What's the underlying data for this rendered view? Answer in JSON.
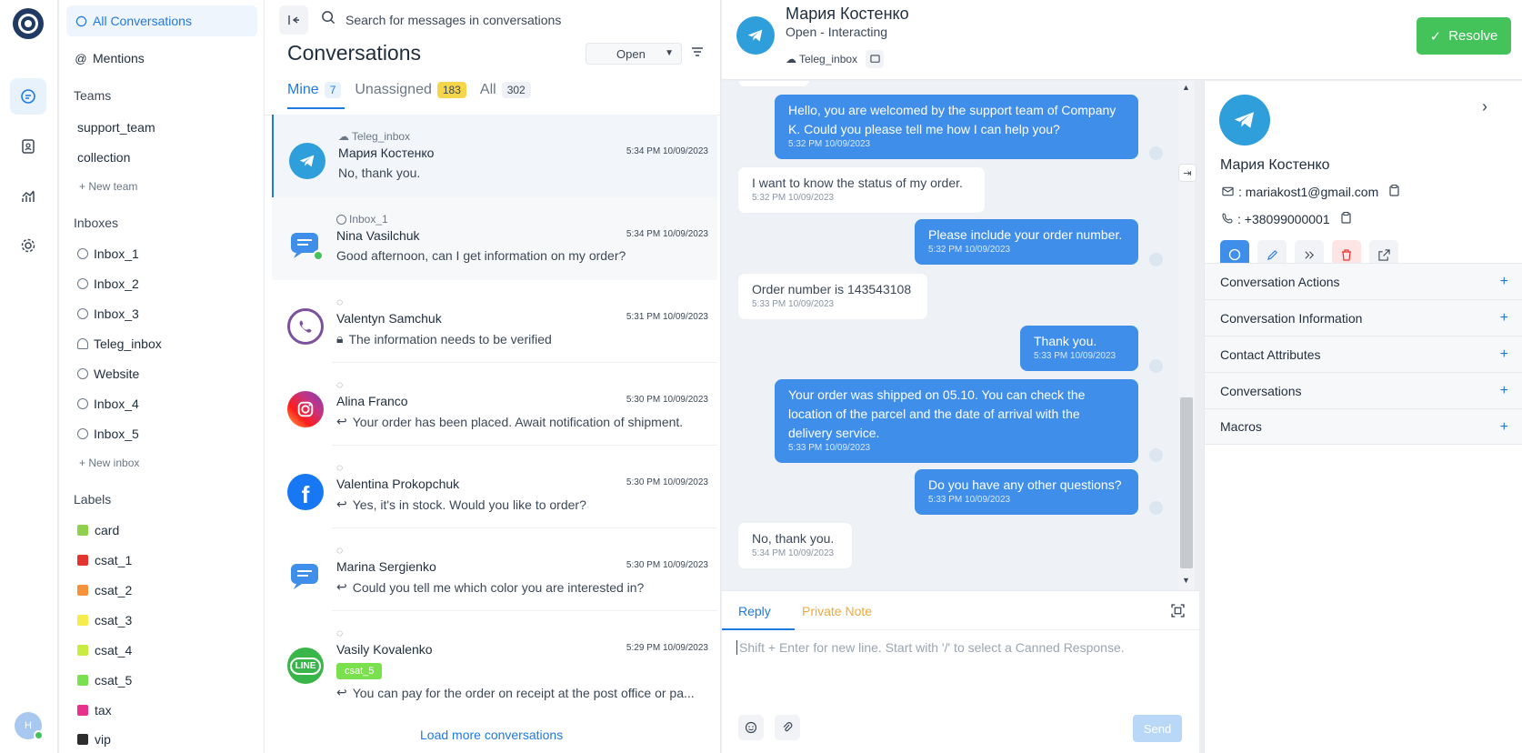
{
  "rail": {
    "avatar_initial": "H",
    "items": [
      {
        "name": "conversations-icon",
        "active": true
      },
      {
        "name": "contacts-icon",
        "active": false
      },
      {
        "name": "reports-icon",
        "active": false
      },
      {
        "name": "settings-icon",
        "active": false
      }
    ]
  },
  "sidebar": {
    "all_conversations": "All Conversations",
    "mentions": "Mentions",
    "teams_heading": "Teams",
    "teams": [
      "support_team",
      "collection"
    ],
    "new_team": "New team",
    "inboxes_heading": "Inboxes",
    "inboxes": [
      "Inbox_1",
      "Inbox_2",
      "Inbox_3",
      "Teleg_inbox",
      "Website",
      "Inbox_4",
      "Inbox_5"
    ],
    "new_inbox": "New inbox",
    "labels_heading": "Labels",
    "labels": [
      {
        "name": "card",
        "color": "#8fd14f"
      },
      {
        "name": "csat_1",
        "color": "#e3342f"
      },
      {
        "name": "csat_2",
        "color": "#f6923a"
      },
      {
        "name": "csat_3",
        "color": "#f7ec4e"
      },
      {
        "name": "csat_4",
        "color": "#c8ec3f"
      },
      {
        "name": "csat_5",
        "color": "#7ae04d"
      },
      {
        "name": "tax",
        "color": "#e8318c"
      },
      {
        "name": "vip",
        "color": "#2d2d2d"
      }
    ]
  },
  "list": {
    "search_placeholder": "Search for messages in conversations",
    "title": "Conversations",
    "status": "Open",
    "tabs": [
      {
        "label": "Mine",
        "count": "7"
      },
      {
        "label": "Unassigned",
        "count": "183"
      },
      {
        "label": "All",
        "count": "302"
      }
    ],
    "conversations": [
      {
        "inbox": "Teleg_inbox",
        "name": "Мария Костенко",
        "time": "5:34 PM 10/09/2023",
        "message": "No, thank you.",
        "channel": "telegram",
        "reply": false,
        "lock": false
      },
      {
        "inbox": "Inbox_1",
        "name": "Nina Vasilchuk",
        "time": "5:34 PM 10/09/2023",
        "message": "Good afternoon, can I get information on my order?",
        "channel": "web",
        "reply": false,
        "lock": false
      },
      {
        "inbox": "",
        "name": "Valentyn Samchuk",
        "time": "5:31 PM 10/09/2023",
        "message": "The information needs to be verified",
        "channel": "viber",
        "reply": false,
        "lock": true
      },
      {
        "inbox": "",
        "name": "Alina Franco",
        "time": "5:30 PM 10/09/2023",
        "message": "Your order has been placed. Await notification of shipment.",
        "channel": "instagram",
        "reply": true,
        "lock": false
      },
      {
        "inbox": "",
        "name": "Valentina Prokopchuk",
        "time": "5:30 PM 10/09/2023",
        "message": "Yes, it's in stock. Would you like to order?",
        "channel": "facebook",
        "reply": true,
        "lock": false
      },
      {
        "inbox": "",
        "name": "Marina Sergienko",
        "time": "5:30 PM 10/09/2023",
        "message": "Could you tell me which color you are interested in?",
        "channel": "web",
        "reply": true,
        "lock": false
      },
      {
        "inbox": "",
        "name": "Vasily Kovalenko",
        "time": "5:29 PM 10/09/2023",
        "message": "You can pay for the order on receipt at the post office or pa...",
        "channel": "line",
        "reply": true,
        "lock": false,
        "label": "csat_5"
      }
    ],
    "load_more": "Load more conversations"
  },
  "chat": {
    "name": "Мария Костенко",
    "status": "Open - Interacting",
    "inbox": "Teleg_inbox",
    "resolve_label": "Resolve",
    "messages": [
      {
        "dir": "out",
        "text": "Hello, you are welcomed by the support team of Company K. Could you please tell me how I can help you?",
        "time": "5:32 PM 10/09/2023"
      },
      {
        "dir": "in",
        "text": "I want to know the status of my order.",
        "time": "5:32 PM 10/09/2023"
      },
      {
        "dir": "out",
        "text": "Please include your order number.",
        "time": "5:32 PM 10/09/2023"
      },
      {
        "dir": "in",
        "text": "Order number is 143543108",
        "time": "5:33 PM 10/09/2023"
      },
      {
        "dir": "out",
        "text": "Thank you.",
        "time": "5:33 PM 10/09/2023"
      },
      {
        "dir": "out",
        "text": "Your order was shipped on 05.10. You can check the location of the parcel and the date of arrival with the delivery service.",
        "time": "5:33 PM 10/09/2023"
      },
      {
        "dir": "out",
        "text": "Do you have any other questions?",
        "time": "5:33 PM 10/09/2023"
      },
      {
        "dir": "in",
        "text": "No, thank you.",
        "time": "5:34 PM 10/09/2023"
      }
    ],
    "reply_tab": "Reply",
    "private_note_tab": "Private Note",
    "reply_placeholder": "Shift + Enter for new line. Start with '/' to select a Canned Response.",
    "send_label": "Send"
  },
  "contact": {
    "name": "Мария Костенко",
    "email": ": mariakost1@gmail.com",
    "phone": ": +38099000001",
    "sections": [
      "Conversation Actions",
      "Conversation Information",
      "Contact Attributes",
      "Conversations",
      "Macros"
    ]
  },
  "colors": {
    "accent": "#1f7ae0",
    "bubble_out": "#3f8ee9",
    "resolve": "#44c35a",
    "telegram": "#2f9fdc"
  }
}
